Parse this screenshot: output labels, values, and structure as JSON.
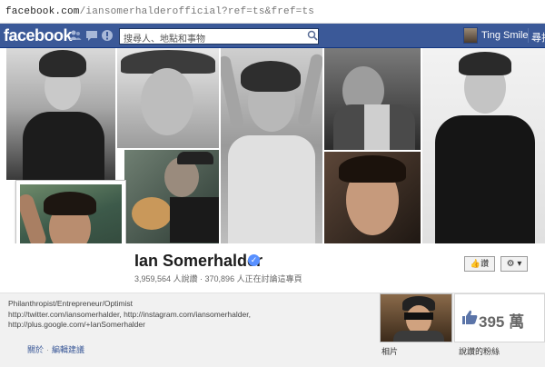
{
  "browser": {
    "url_main": "facebook.com",
    "url_rest": "/iansomerhalderofficial?ref=ts&fref=ts"
  },
  "header": {
    "logo": "facebook",
    "search_placeholder": "搜尋人、地點和事物",
    "user_name": "Ting Smile",
    "home_label": "尋找",
    "icons": [
      "friend-requests-icon",
      "messages-icon",
      "notifications-icon",
      "search-icon"
    ],
    "brand_color": "#3b5998"
  },
  "profile": {
    "name": "Ian Somerhalder",
    "verified": true,
    "stats": "3,959,564 人說讚 · 370,896 人正在討論這專頁",
    "like_button": "讚",
    "settings_button": "⚙ ▾"
  },
  "about": {
    "tagline": "Philanthropist/Entrepreneur/Optimist",
    "links_line1": "http://twitter.com/iansomerhalder, http://instagram.com/iansomerhalder,",
    "links_line2": "http://plus.google.com/+IanSomerhalder",
    "about_link": "關於",
    "edit_link": "編輯建議",
    "photos_label": "相片",
    "likes_count": "395 萬",
    "likes_label": "說讚的粉絲"
  }
}
